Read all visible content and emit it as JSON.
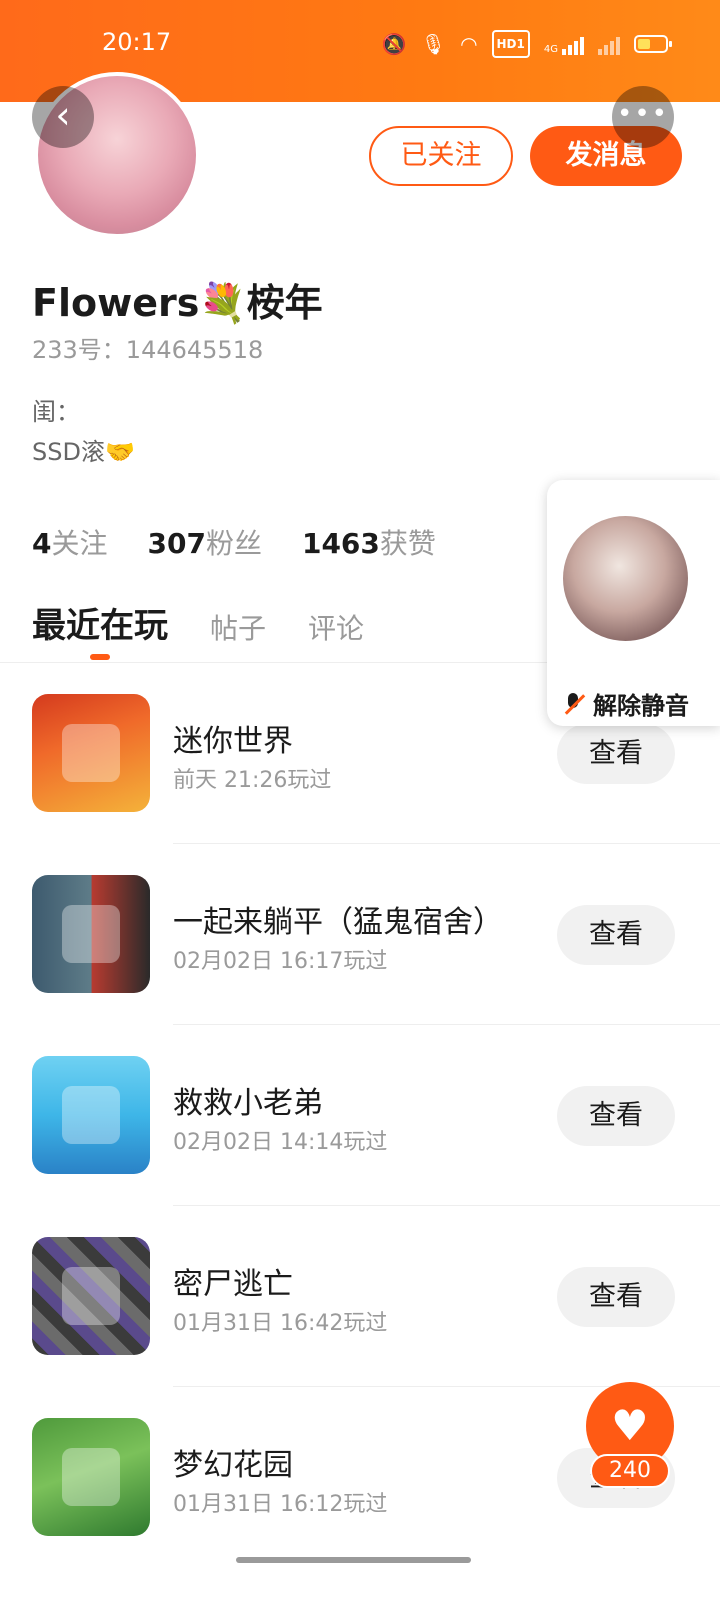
{
  "status_bar": {
    "time": "20:17",
    "icons": [
      "mute-vibrate-icon",
      "mic-icon",
      "wifi-icon",
      "hd-icon",
      "signal-4g-icon",
      "signal-x-icon",
      "battery-icon"
    ],
    "hd_label": "HD1",
    "network_label": "4G",
    "battery_level": 0.45
  },
  "header": {
    "back_glyph": "‹",
    "more_glyph": "•••",
    "followed_label": "已关注",
    "message_label": "发消息"
  },
  "profile": {
    "username": "Flowers💐桉年",
    "id_line": "233号：144645518",
    "bio_line1": "闺：",
    "bio_line2": "SSD滚🤝"
  },
  "stats": [
    {
      "value": "4",
      "label": "关注"
    },
    {
      "value": "307",
      "label": "粉丝"
    },
    {
      "value": "1463",
      "label": "获赞"
    }
  ],
  "tabs": [
    {
      "label": "最近在玩",
      "active": true
    },
    {
      "label": "帖子",
      "active": false
    },
    {
      "label": "评论",
      "active": false
    }
  ],
  "games": [
    {
      "name": "迷你世界",
      "time": "前天 21:26玩过",
      "action": "查看"
    },
    {
      "name": "一起来躺平（猛鬼宿舍）",
      "time": "02月02日 16:17玩过",
      "action": "查看"
    },
    {
      "name": "救救小老弟",
      "time": "02月02日 14:14玩过",
      "action": "查看"
    },
    {
      "name": "密尸逃亡",
      "time": "01月31日 16:42玩过",
      "action": "查看"
    },
    {
      "name": "梦幻花园",
      "time": "01月31日 16:12玩过",
      "action": "查看"
    }
  ],
  "mute_card": {
    "label": "解除静音"
  },
  "like_fab": {
    "icon": "heart-icon",
    "glyph": "♥",
    "count": "240"
  },
  "colors": {
    "accent": "#ff5a14",
    "status_bar": "#ff7a12"
  }
}
